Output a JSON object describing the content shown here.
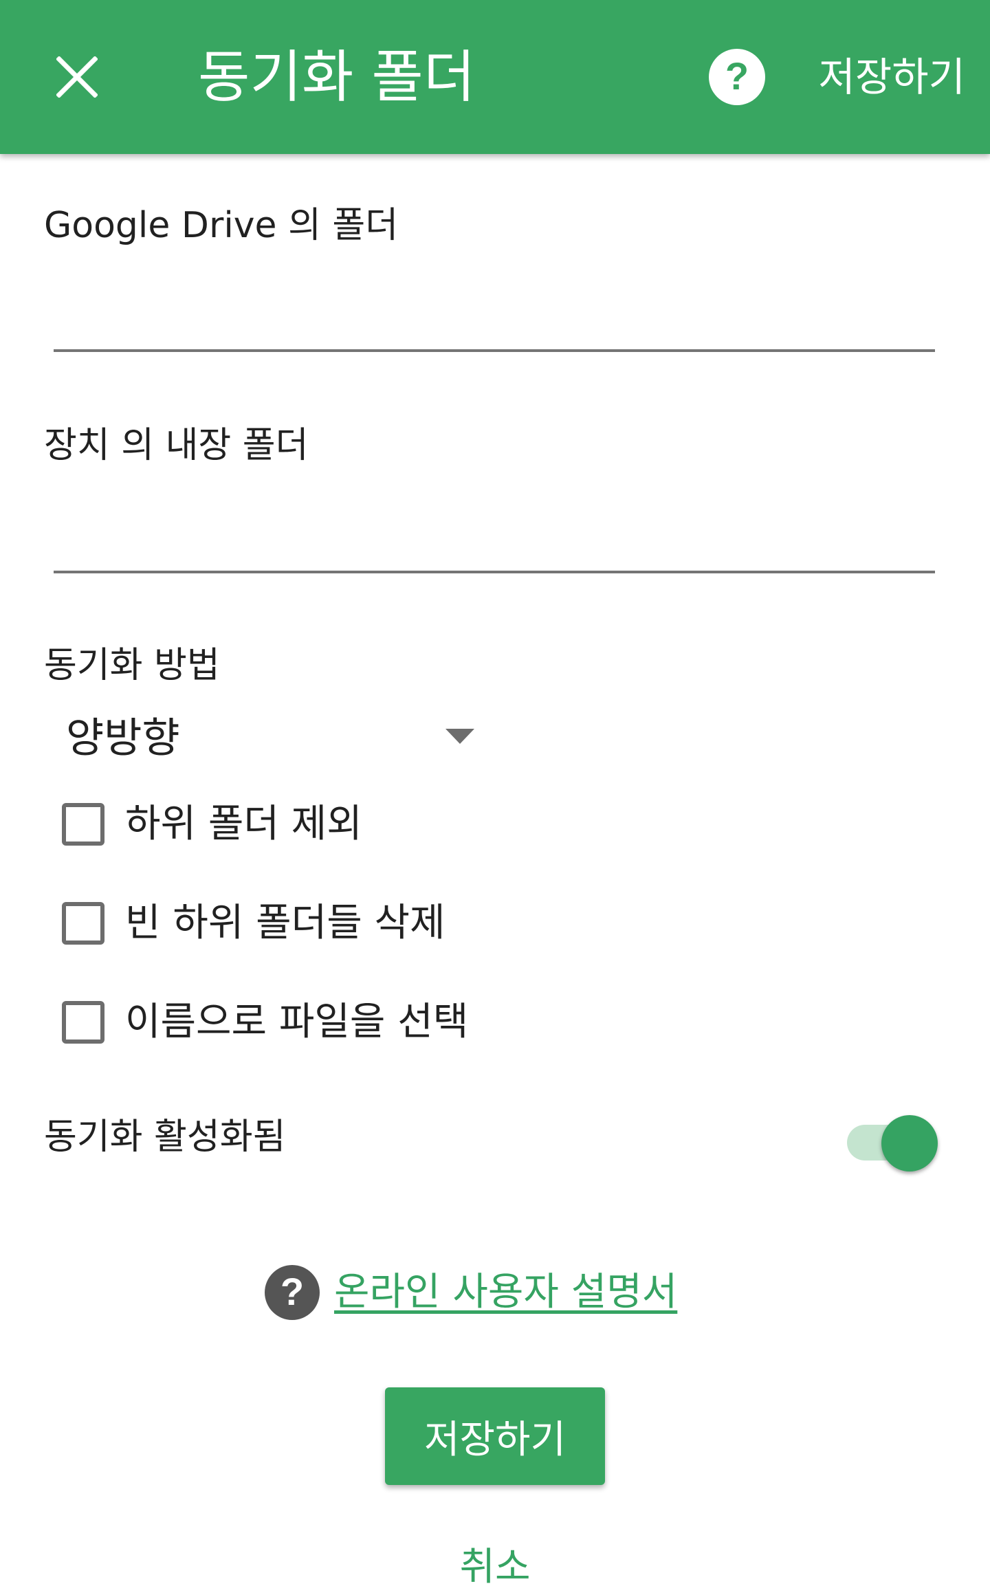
{
  "colors": {
    "primary": "#38a661",
    "accent": "#35a362",
    "switch_track": "#c4e4cf",
    "text": "#212121",
    "underline": "#757575"
  },
  "appbar": {
    "title": "동기화 폴더",
    "close_icon": "close-icon",
    "help_icon": "help-circle-icon",
    "save_label": "저장하기"
  },
  "form": {
    "drive_folder": {
      "label": "Google Drive 의 폴더",
      "value": ""
    },
    "local_folder": {
      "label": "장치 의 내장 폴더",
      "value": ""
    },
    "sync_method": {
      "label": "동기화 방법",
      "selected": "양방향",
      "arrow_icon": "dropdown-arrow-icon"
    },
    "checkboxes": [
      {
        "label": "하위 폴더 제외",
        "checked": false
      },
      {
        "label": "빈 하위 폴더들 삭제",
        "checked": false
      },
      {
        "label": "이름으로 파일을 선택",
        "checked": false
      }
    ],
    "sync_enabled": {
      "label": "동기화 활성화됨",
      "on": true
    }
  },
  "manual": {
    "icon": "help-circle-icon",
    "link_text": "온라인 사용자 설명서"
  },
  "buttons": {
    "save": "저장하기",
    "cancel": "취소"
  }
}
